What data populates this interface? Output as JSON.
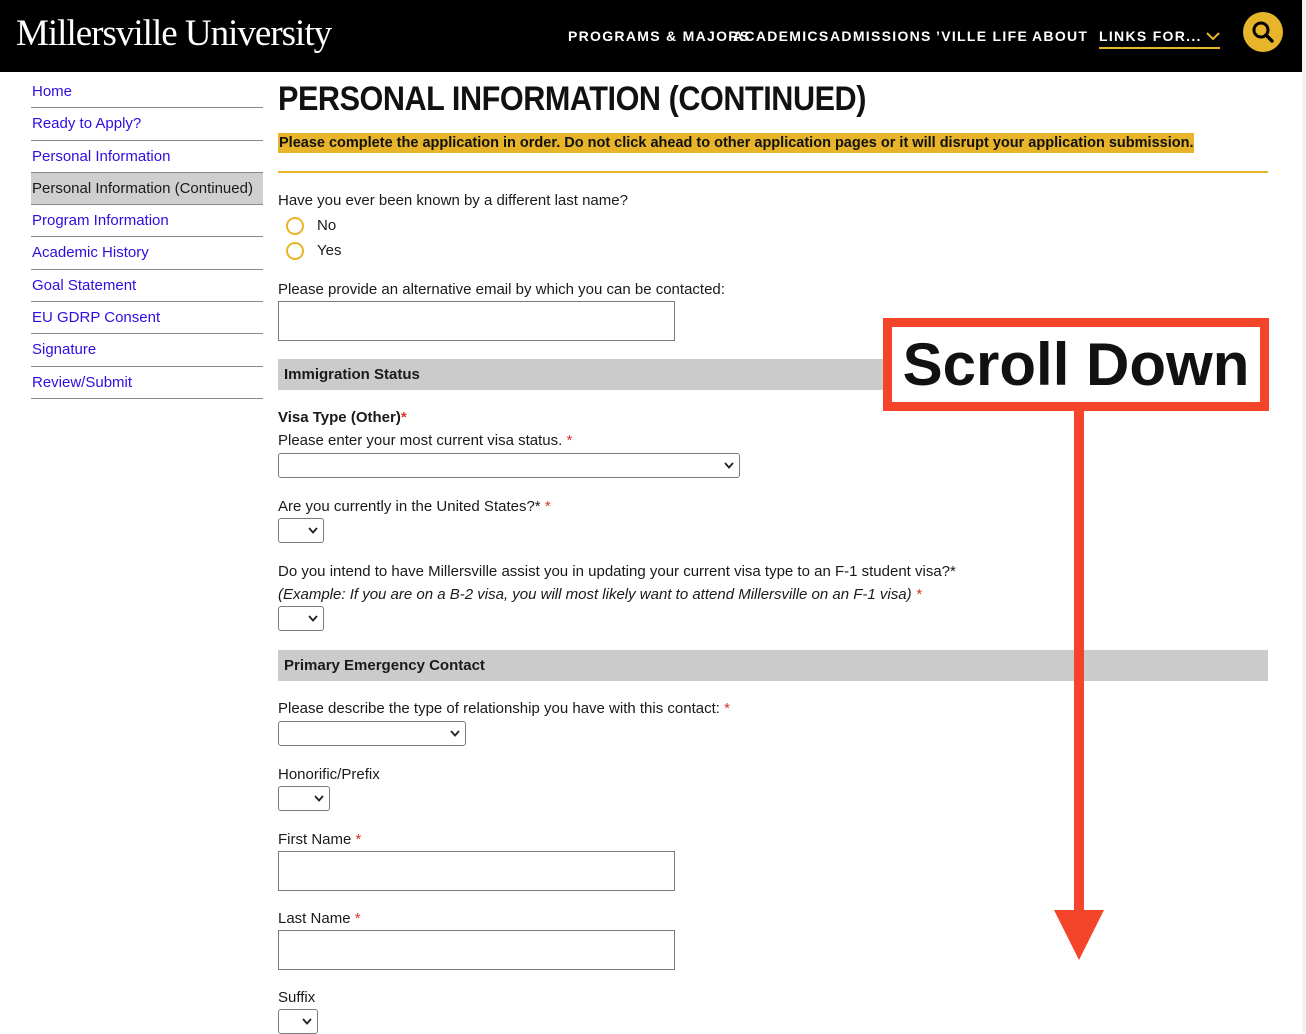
{
  "header": {
    "logo": "Millersville University",
    "nav": [
      "PROGRAMS & MAJORS",
      "ACADEMICS",
      "ADMISSIONS",
      "’VILLE LIFE",
      "ABOUT"
    ],
    "links_for": "LINKS FOR...",
    "accent": "#e8b52a"
  },
  "sidebar": {
    "items": [
      {
        "label": "Home"
      },
      {
        "label": "Ready to Apply?"
      },
      {
        "label": "Personal Information"
      },
      {
        "label": "Personal Information (Continued)",
        "active": true
      },
      {
        "label": "Program Information"
      },
      {
        "label": "Academic History"
      },
      {
        "label": "Goal Statement"
      },
      {
        "label": "EU GDRP Consent"
      },
      {
        "label": "Signature"
      },
      {
        "label": "Review/Submit"
      }
    ]
  },
  "main": {
    "title": "PERSONAL INFORMATION (CONTINUED)",
    "warning": "Please complete the application in order. Do not click ahead to other application pages or it will disrupt your application submission.",
    "last_name_question": "Have you ever been known by a different last name?",
    "radio_no": "No",
    "radio_yes": "Yes",
    "alt_email_label": "Please provide an alternative email by which you can be contacted:",
    "immigration_section": "Immigration Status",
    "visa_type_label": "Visa Type (Other)",
    "visa_status_label": "Please enter your most current visa status.",
    "in_us_label": "Are you currently in the United States?*",
    "f1_label": "Do you intend to have Millersville assist you in updating your current visa type to an F-1 student visa?*",
    "f1_example": "(Example: If you are on a B-2 visa, you will most likely want to attend Millersville on an F-1 visa)",
    "emergency_section": "Primary Emergency Contact",
    "relationship_label": "Please describe the type of relationship you have with this contact:",
    "honorific_label": "Honorific/Prefix",
    "first_name_label": "First Name",
    "last_name_label": "Last Name",
    "suffix_label": "Suffix",
    "required_mark": "*"
  },
  "overlay": {
    "text": "Scroll Down",
    "color": "#f4452a"
  }
}
